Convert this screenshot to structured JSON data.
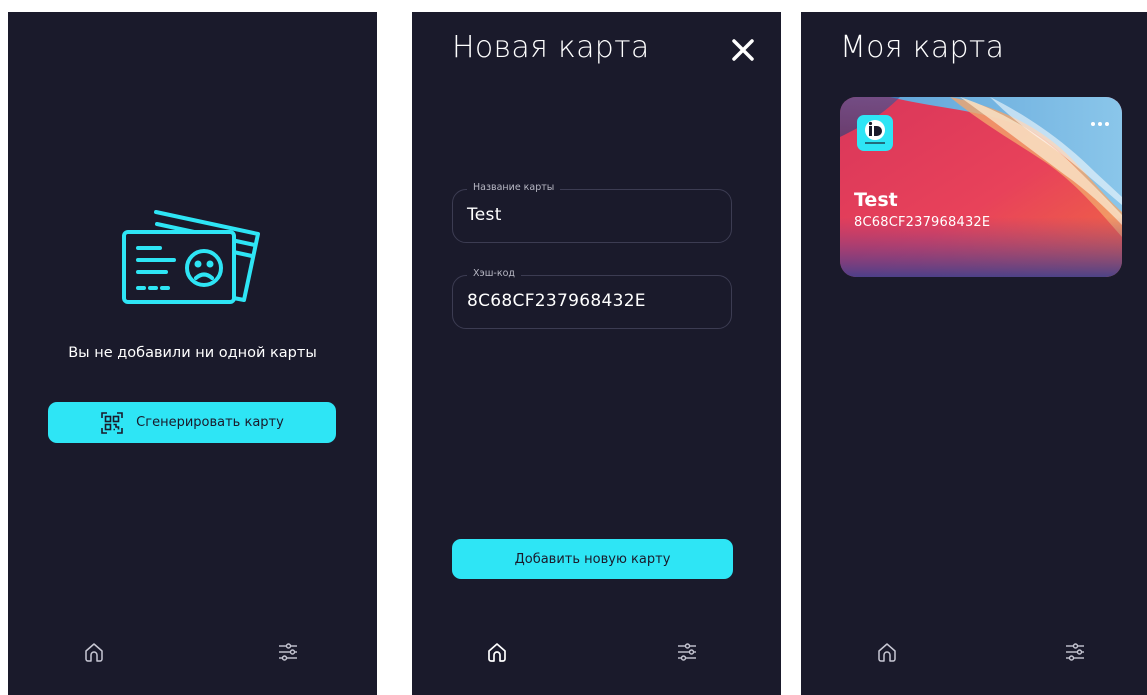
{
  "colors": {
    "background": "#1a1a2b",
    "accent": "#2ee5f5",
    "field_border": "#3c3c52"
  },
  "screen_empty": {
    "illustration": "sad-id-card-icon",
    "message": "Вы не добавили ни одной карты",
    "generate_button": {
      "icon": "qr-code-icon",
      "label": "Сгенерировать карту"
    },
    "nav": [
      "home-icon",
      "sliders-icon"
    ]
  },
  "screen_new_card": {
    "title": "Новая карта",
    "close_icon": "close-icon",
    "fields": {
      "name": {
        "label": "Название карты",
        "value": "Test"
      },
      "hash": {
        "label": "Хэш-код",
        "value": "8C68CF237968432E"
      }
    },
    "add_button_label": "Добавить новую карту",
    "nav": [
      "home-icon",
      "sliders-icon"
    ]
  },
  "screen_my_card": {
    "title": "Моя карта",
    "card": {
      "logo": "iD",
      "name": "Test",
      "hash": "8C68CF237968432E",
      "menu_icon": "more-dots-icon"
    },
    "nav": [
      "home-icon",
      "sliders-icon"
    ]
  }
}
